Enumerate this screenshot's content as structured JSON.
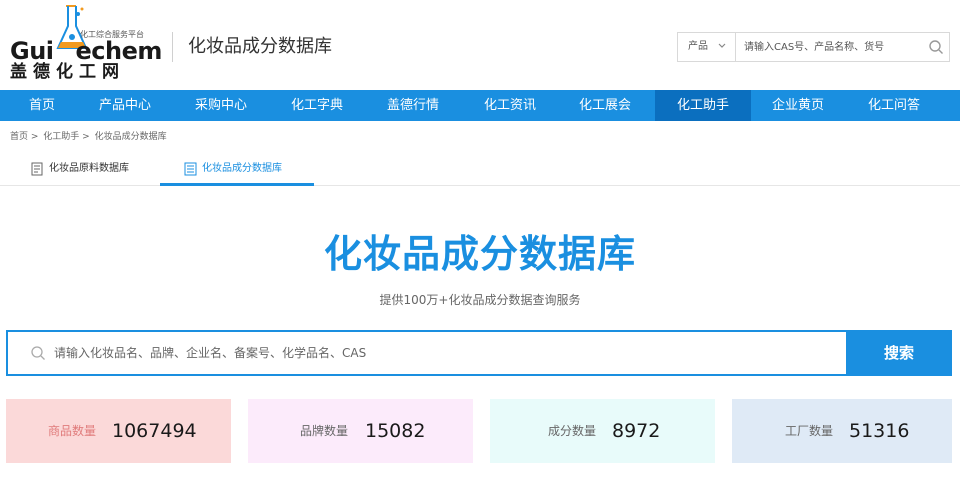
{
  "header": {
    "logo": {
      "slogan": "化工综合服务平台",
      "word_part1": "Gui",
      "word_part2": "echem",
      "cn_name": "盖德化工网"
    },
    "site_title": "化妆品成分数据库",
    "search": {
      "select_value": "产品",
      "placeholder": "请输入CAS号、产品名称、货号"
    }
  },
  "nav": {
    "items": [
      {
        "label": "首页"
      },
      {
        "label": "产品中心"
      },
      {
        "label": "采购中心"
      },
      {
        "label": "化工字典"
      },
      {
        "label": "盖德行情"
      },
      {
        "label": "化工资讯"
      },
      {
        "label": "化工展会"
      },
      {
        "label": "化工助手"
      },
      {
        "label": "企业黄页"
      },
      {
        "label": "化工问答"
      }
    ],
    "active_index": 7
  },
  "breadcrumb": [
    "首页 >",
    "化工助手 >",
    "化妆品成分数据库"
  ],
  "tabs": [
    {
      "label": "化妆品原料数据库"
    },
    {
      "label": "化妆品成分数据库"
    }
  ],
  "hero": {
    "title": "化妆品成分数据库",
    "subtitle": "提供100万+化妆品成分数据查询服务"
  },
  "main_search": {
    "placeholder": "请输入化妆品名、品牌、企业名、备案号、化学品名、CAS",
    "button": "搜索"
  },
  "stats": [
    {
      "label": "商品数量",
      "value": "1067494",
      "bg": "#fbd9d9",
      "label_color": "#e07b7b"
    },
    {
      "label": "品牌数量",
      "value": "15082",
      "bg": "#fcebfb",
      "label_color": "#666666"
    },
    {
      "label": "成分数量",
      "value": "8972",
      "bg": "#e8fbfa",
      "label_color": "#666666"
    },
    {
      "label": "工厂数量",
      "value": "51316",
      "bg": "#dfeaf6",
      "label_color": "#666666"
    }
  ],
  "colors": {
    "accent": "#1a8fe0",
    "nav_active": "#0b6fbf",
    "logo_orange": "#f29a1f"
  }
}
